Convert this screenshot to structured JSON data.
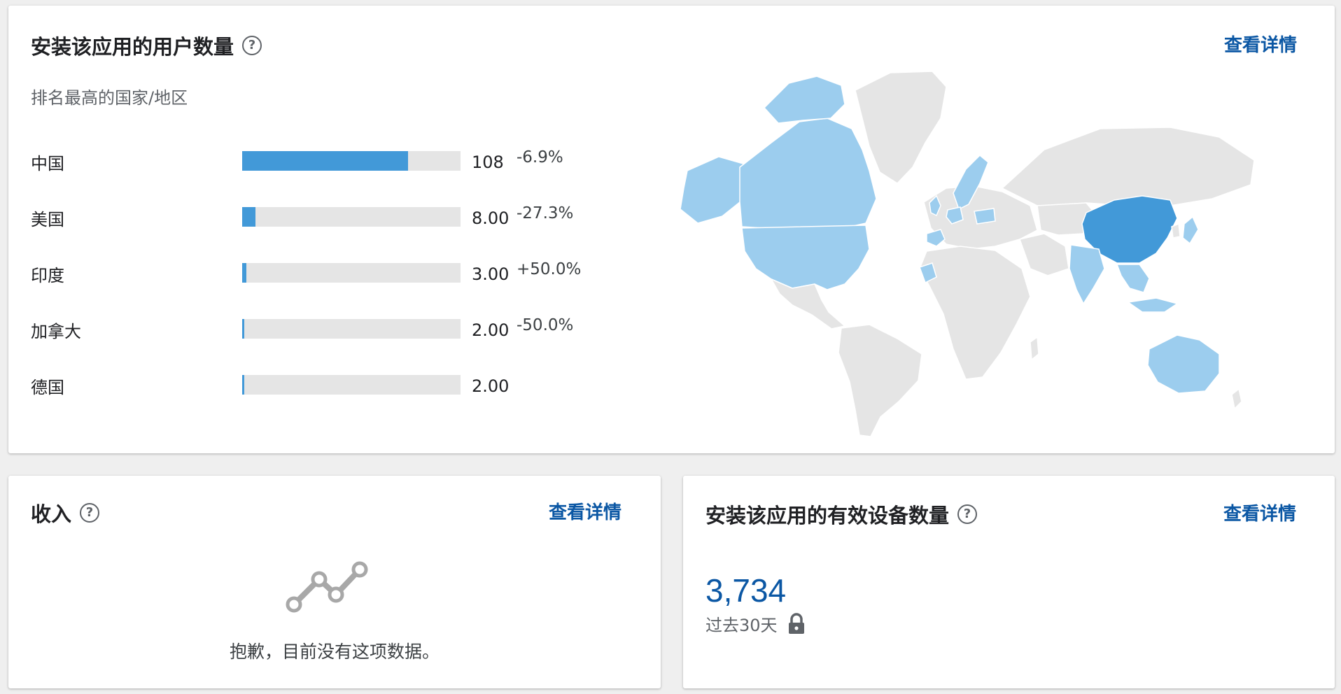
{
  "installs": {
    "title": "安装该应用的用户数量",
    "help_glyph": "?",
    "details_link": "查看详情",
    "subtitle": "排名最高的国家/地区",
    "countries": [
      {
        "name": "中国",
        "value": "108",
        "change": "-6.9%",
        "share": 0.76
      },
      {
        "name": "美国",
        "value": "8.00",
        "change": "-27.3%",
        "share": 0.062
      },
      {
        "name": "印度",
        "value": "3.00",
        "change": "+50.0%",
        "share": 0.02
      },
      {
        "name": "加拿大",
        "value": "2.00",
        "change": "-50.0%",
        "share": 0.01
      },
      {
        "name": "德国",
        "value": "2.00",
        "change": "",
        "share": 0.01
      }
    ],
    "map_colors": {
      "base": "#e5e5e5",
      "light": "#9ccdee",
      "medium": "#7ab8e6",
      "strong": "#4299d8"
    }
  },
  "revenue": {
    "title": "收入",
    "help_glyph": "?",
    "details_link": "查看详情",
    "empty_icon": "chart-line-icon",
    "empty_message": "抱歉，目前没有这项数据。"
  },
  "devices": {
    "title": "安装该应用的有效设备数量",
    "help_glyph": "?",
    "details_link": "查看详情",
    "value": "3,734",
    "period": "过去30天",
    "period_icon": "lock-icon"
  },
  "colors": {
    "link": "#0b57a4",
    "bar": "#4299d8",
    "track": "#e5e5e5"
  }
}
